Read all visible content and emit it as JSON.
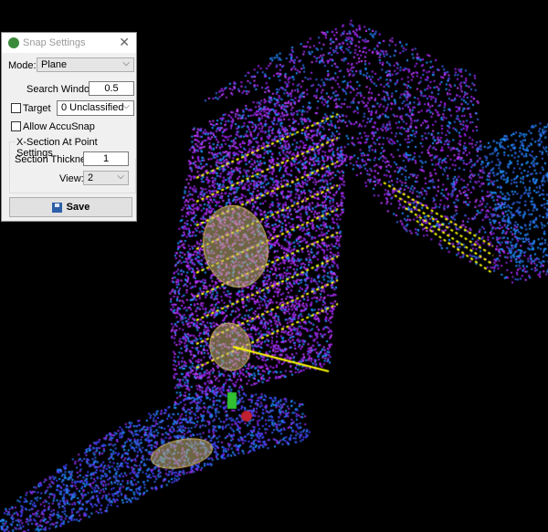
{
  "dialog": {
    "title": "Snap Settings",
    "close_icon": "close-icon",
    "mode_label": "Mode:",
    "mode_value": "Plane",
    "search_window_label": "Search Window:",
    "search_window_value": "0.5",
    "target_label": "Target",
    "target_checked": false,
    "target_class_value": "0   Unclassified",
    "allow_accusnap_label": "Allow AccuSnap",
    "allow_accusnap_checked": false,
    "xsection_group_label": "X-Section At Point Settings",
    "section_thickness_label": "Section Thickness:",
    "section_thickness_value": "1",
    "view_label": "View:",
    "view_value": "2",
    "save_label": "Save"
  },
  "viewport": {
    "background": "#000000",
    "point_colors": [
      "#8a2be2",
      "#a020f0",
      "#4040ff",
      "#1e90ff",
      "#c040ff",
      "#3060e0"
    ],
    "highlight_color": "#ffff00"
  }
}
